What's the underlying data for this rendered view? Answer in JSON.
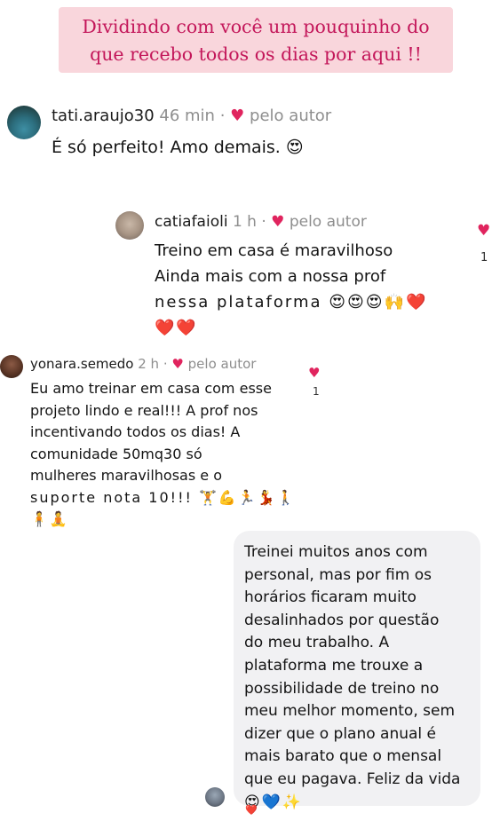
{
  "banner": {
    "line1": "Dividindo com você um pouquinho do",
    "line2": "que recebo todos os dias por aqui !!"
  },
  "comments": [
    {
      "username": "tati.araujo30",
      "time": "46 min",
      "sep": "·",
      "liked_by": "pelo autor",
      "lines": [
        "É só perfeito! Amo demais. 😍"
      ],
      "likes": ""
    },
    {
      "username": "catiafaioli",
      "time": "1 h",
      "sep": "·",
      "liked_by": "pelo autor",
      "lines": [
        "Treino em casa é maravilhoso",
        "Ainda mais com a nossa prof",
        "nessa plataforma 😍😍😍🙌❤️",
        "❤️❤️"
      ],
      "likes": "1"
    },
    {
      "username": "yonara.semedo",
      "time": "2 h",
      "sep": "·",
      "liked_by": "pelo autor",
      "lines": [
        "Eu amo treinar em casa com esse",
        "projeto lindo e real!!! A prof nos",
        "incentivando todos os dias! A",
        "comunidade 50mq30  só",
        "mulheres maravilhosas  e o",
        "suporte  nota 10!!! 🏋️💪🏃💃🚶",
        "🧍🧘"
      ],
      "likes": "1"
    }
  ],
  "message": {
    "lines": [
      "Treinei muitos anos com",
      "personal, mas por fim os",
      "horários ficaram muito",
      "desalinhados por questão",
      "do meu trabalho. A",
      "plataforma me trouxe a",
      "possibilidade de treino no",
      "meu melhor momento, sem",
      "dizer que o plano anual é",
      "mais barato que o mensal",
      "que eu pagava. Feliz da vida",
      "😍💙✨"
    ],
    "reaction": "❤️"
  },
  "icons": {
    "heart": "♥",
    "liked_heart": "♥"
  },
  "colors": {
    "banner_bg": "#f9d6dc",
    "banner_text": "#c3175a",
    "heart": "#e0245e",
    "bubble_bg": "#f1f1f3"
  }
}
